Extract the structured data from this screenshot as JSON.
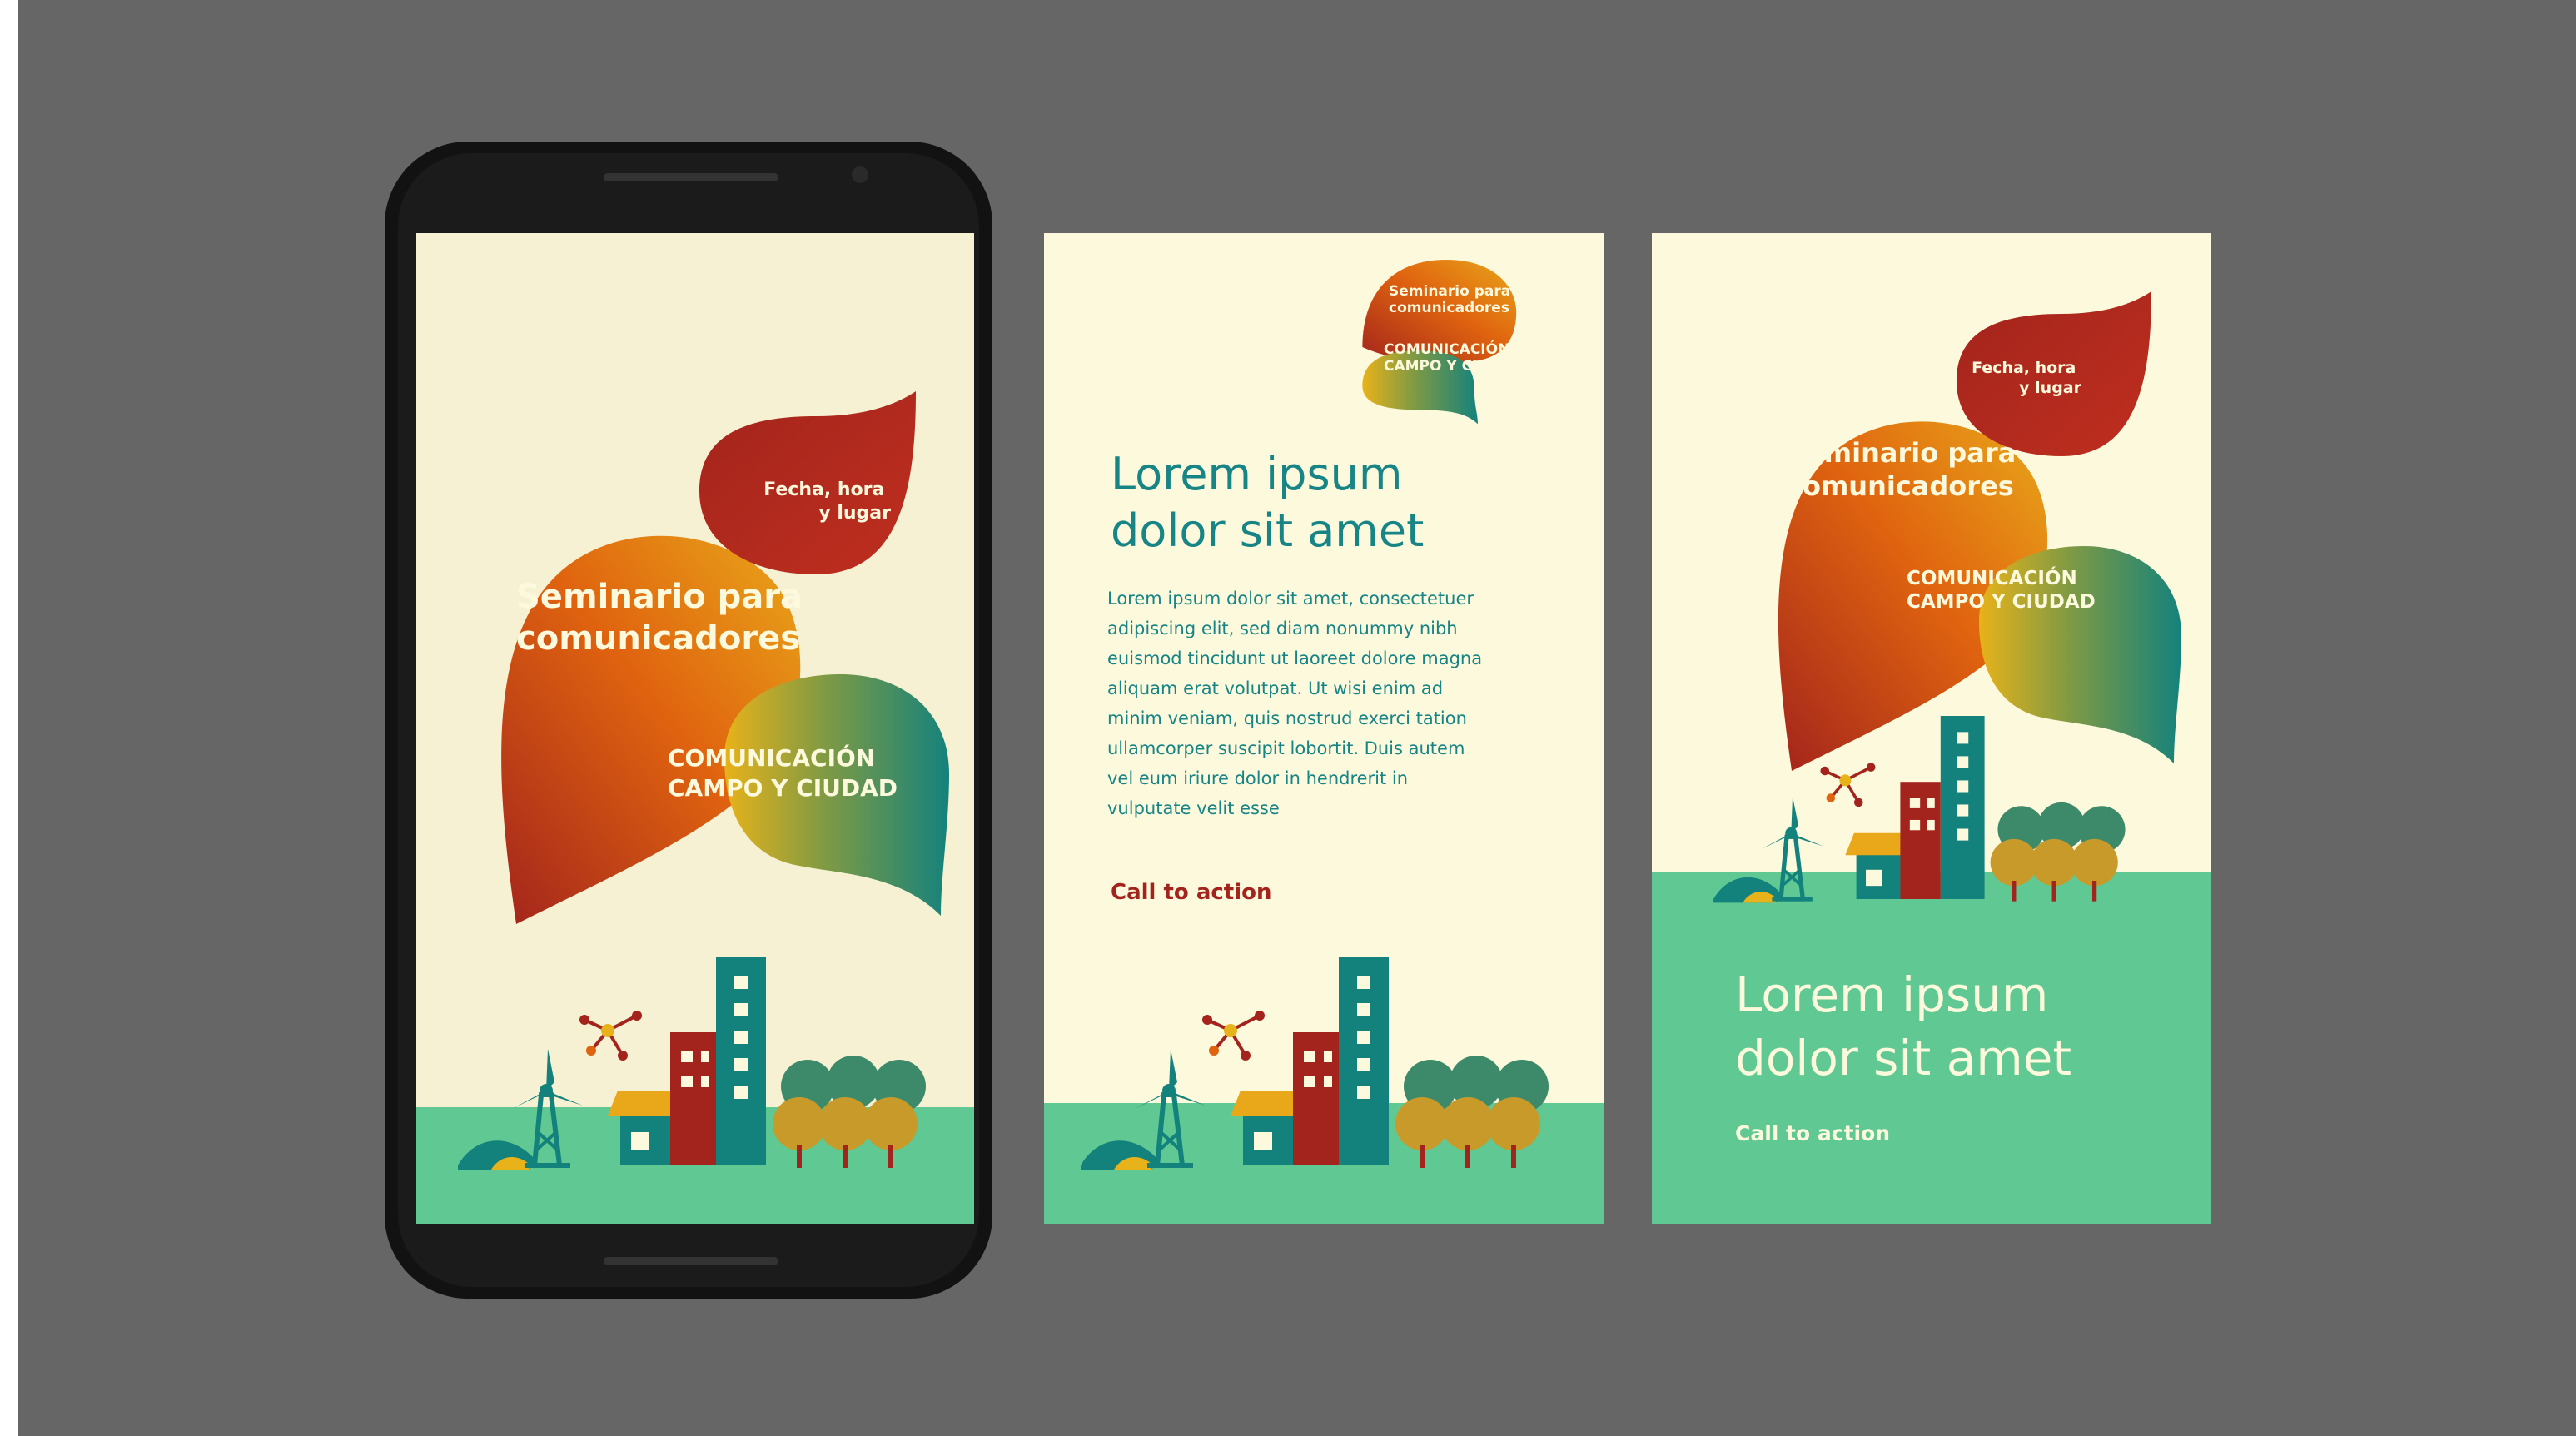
{
  "colors": {
    "background_gray": "#666666",
    "cream": "#fdf9dc",
    "grass": "#5fc893",
    "teal": "#14827c",
    "dark_red": "#a3241c",
    "orange": "#e6840a",
    "yellow": "#e8b21a",
    "text_teal": "#178486",
    "cta_red": "#a3241c"
  },
  "event": {
    "title_line1": "Seminario para",
    "title_line2": "comunicadores",
    "date_line1": "Fecha, hora",
    "date_line2": "y lugar",
    "theme_line1": "COMUNICACIÓN",
    "theme_line2": "CAMPO Y CIUDAD"
  },
  "content": {
    "heading_line1": "Lorem ipsum",
    "heading_line2": "dolor sit amet",
    "body_lines": [
      "Lorem ipsum dolor sit amet, consectetuer",
      "adipiscing elit, sed diam nonummy nibh",
      "euismod tincidunt ut laoreet dolore magna",
      "aliquam erat volutpat. Ut wisi enim ad",
      "minim veniam, quis nostrud exerci tation",
      "ullamcorper suscipit lobortit. Duis autem",
      "vel eum iriure dolor in hendrerit in",
      "vulputate velit esse"
    ],
    "cta_label": "Call to action"
  },
  "icons": [
    "phone-frame",
    "wind-turbine-icon",
    "molecule-icon",
    "house-icon",
    "building-icon",
    "tree-icon",
    "bush-icon"
  ]
}
